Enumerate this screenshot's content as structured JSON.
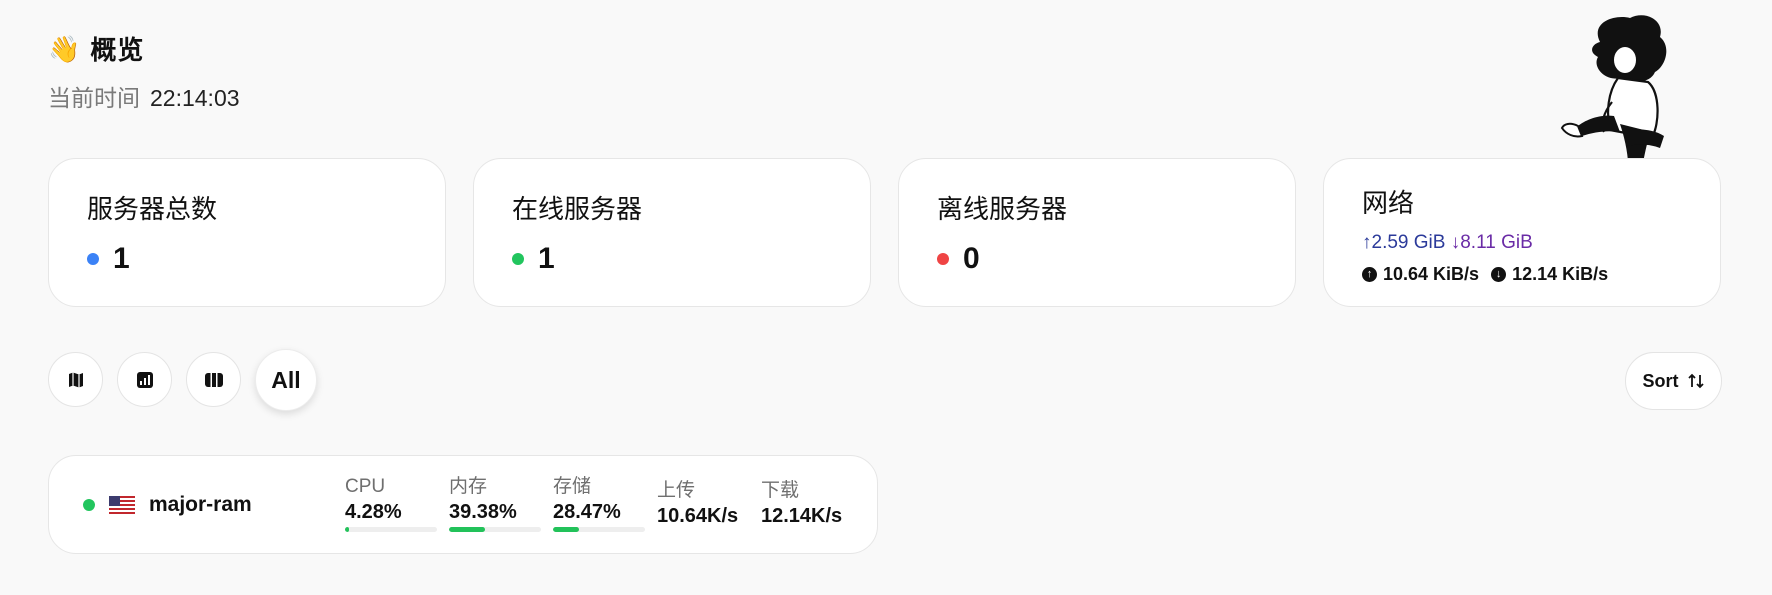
{
  "header": {
    "wave_emoji": "👋",
    "title": "概览",
    "time_label": "当前时间",
    "time_value": "22:14:03"
  },
  "cards": {
    "total": {
      "label": "服务器总数",
      "value": "1",
      "dot_color": "#3b82f6"
    },
    "online": {
      "label": "在线服务器",
      "value": "1",
      "dot_color": "#22c55e"
    },
    "offline": {
      "label": "离线服务器",
      "value": "0",
      "dot_color": "#ef4444"
    },
    "network": {
      "label": "网络",
      "up_total": "↑2.59 GiB",
      "down_total": "↓8.11 GiB",
      "up_speed": "10.64 KiB/s",
      "down_speed": "12.14 KiB/s",
      "up_icon": "arrow-up-circle-icon",
      "down_icon": "arrow-down-circle-icon"
    }
  },
  "toolbar": {
    "map_icon": "map-icon",
    "chart_icon": "bar-chart-icon",
    "columns_icon": "columns-icon",
    "all_label": "All",
    "sort_label": "Sort",
    "sort_icon": "sort-arrows-icon"
  },
  "server": {
    "status_color": "#22c55e",
    "flag_icon": "us-flag-icon",
    "name": "major-ram",
    "metrics": {
      "cpu": {
        "label": "CPU",
        "value": "4.28%",
        "percent": 4.28
      },
      "mem": {
        "label": "内存",
        "value": "39.38%",
        "percent": 39.38
      },
      "disk": {
        "label": "存储",
        "value": "28.47%",
        "percent": 28.47
      },
      "upload": {
        "label": "上传",
        "value": "10.64K/s"
      },
      "download": {
        "label": "下载",
        "value": "12.14K/s"
      }
    }
  }
}
